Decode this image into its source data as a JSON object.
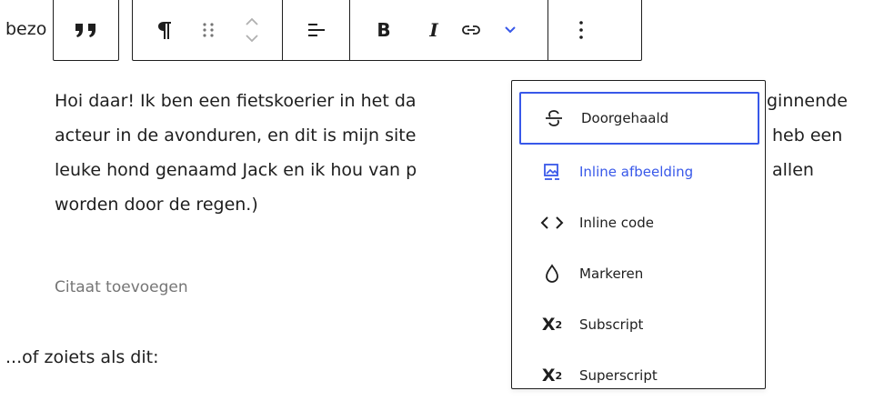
{
  "editor": {
    "paragraph_top_visible": "bezo",
    "paragraph_top_tail": ".",
    "quote_lines": [
      {
        "left": "Hoi daar! Ik ben een fietskoerier in het da",
        "right": "ginnende"
      },
      {
        "left": "acteur in de avonduren, en dit is mijn site",
        "right": "heb een"
      },
      {
        "left": "leuke hond genaamd Jack en ik hou van p",
        "right": "allen"
      },
      {
        "left": "worden door de regen.)",
        "right": ""
      }
    ],
    "citation_placeholder": "Citaat toevoegen",
    "next_paragraph": "...of zoiets als dit:"
  },
  "toolbar": {
    "quote_icon": "quote-icon",
    "buttons": [
      {
        "name": "paragraph-icon"
      },
      {
        "name": "drag-handle-icon"
      },
      {
        "name": "move-up-down-icon"
      },
      {
        "name": "align-icon"
      },
      {
        "name": "bold-icon"
      },
      {
        "name": "italic-icon"
      },
      {
        "name": "link-icon"
      },
      {
        "name": "more-formatting-chevron-icon"
      },
      {
        "name": "options-icon"
      }
    ],
    "accent_color": "#3858e9"
  },
  "dropdown": {
    "items": [
      {
        "label": "Doorgehaald",
        "icon": "strikethrough-icon",
        "state": "focused"
      },
      {
        "label": "Inline afbeelding",
        "icon": "inline-image-icon",
        "state": "active"
      },
      {
        "label": "Inline code",
        "icon": "code-icon",
        "state": ""
      },
      {
        "label": "Markeren",
        "icon": "highlight-drop-icon",
        "state": ""
      },
      {
        "label": "Subscript",
        "icon": "subscript-icon",
        "state": ""
      },
      {
        "label": "Superscript",
        "icon": "superscript-icon",
        "state": ""
      }
    ],
    "focus_color": "#3858e9",
    "active_color": "#3858e9"
  }
}
